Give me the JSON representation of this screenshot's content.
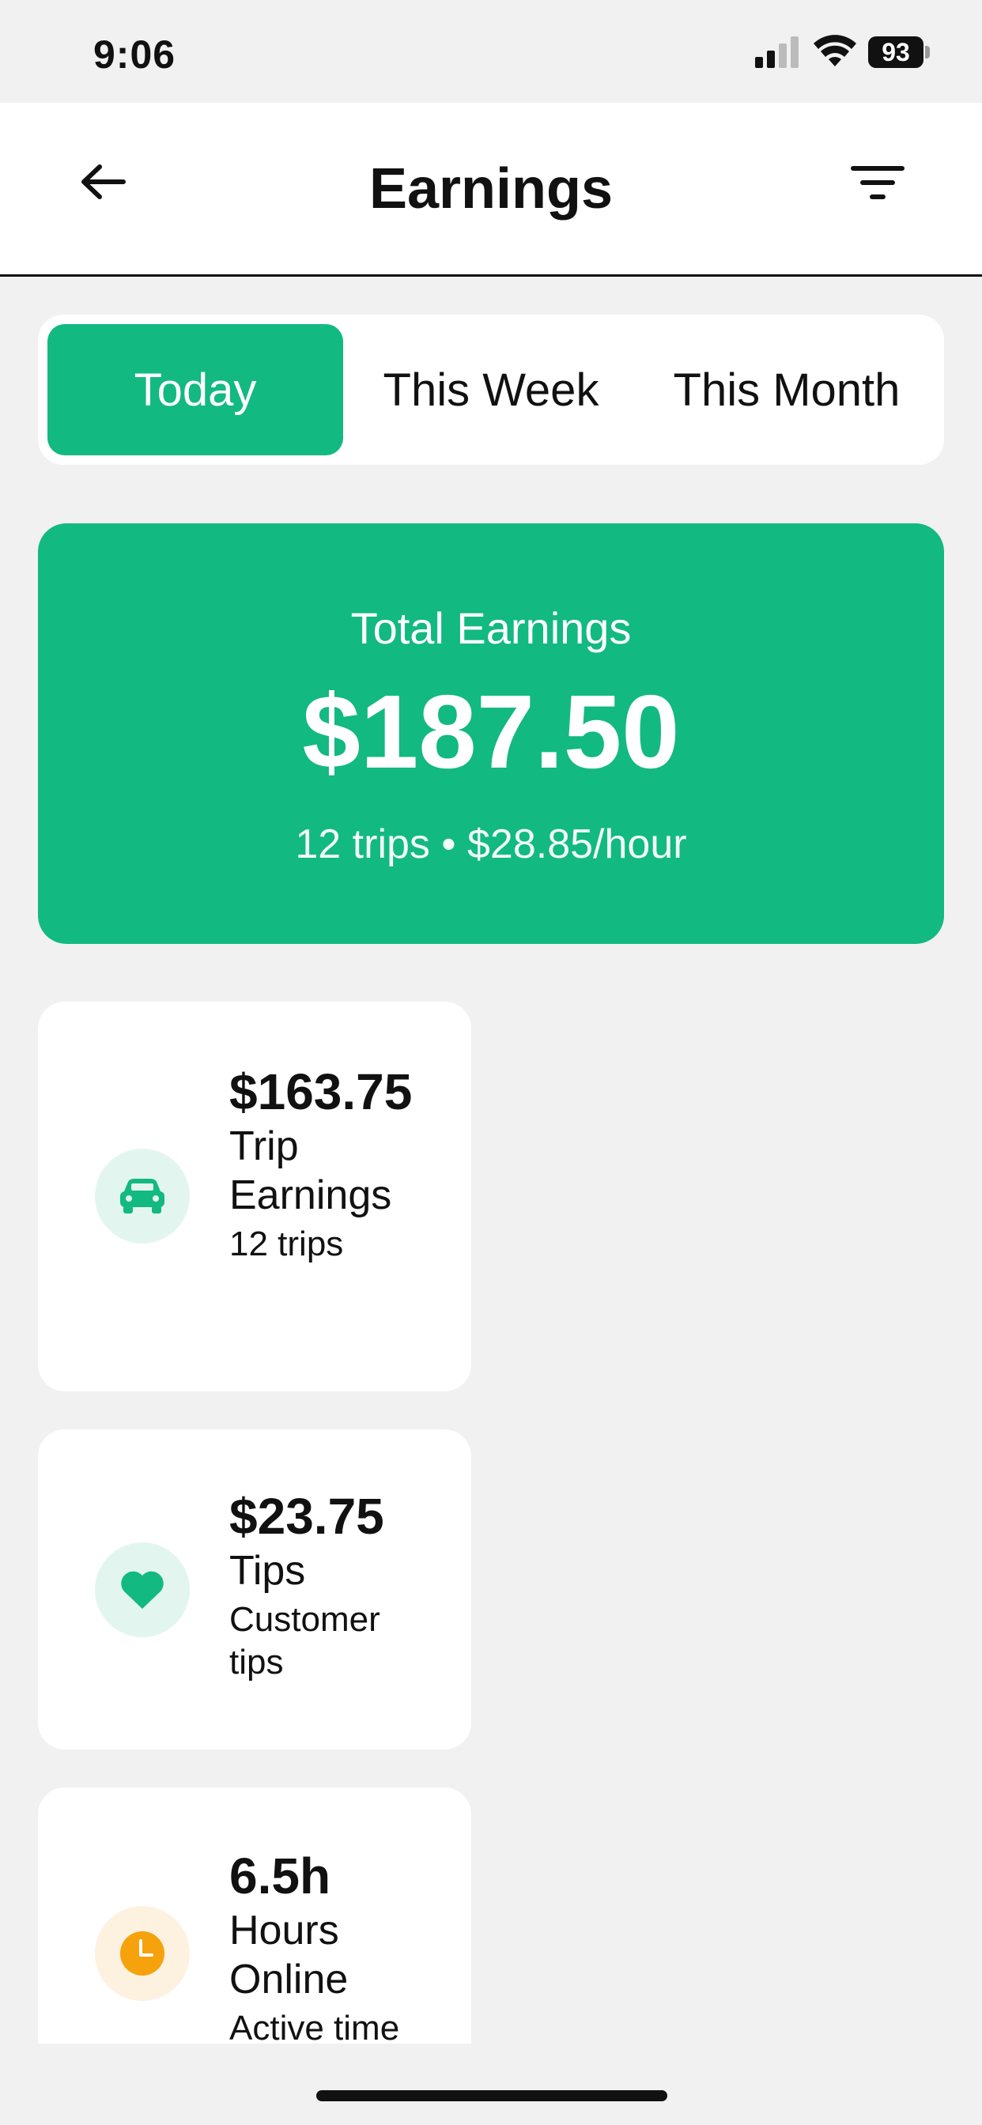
{
  "status_bar": {
    "time": "9:06",
    "battery": "93"
  },
  "header": {
    "title": "Earnings"
  },
  "tabs": [
    {
      "label": "Today",
      "active": true
    },
    {
      "label": "This Week",
      "active": false
    },
    {
      "label": "This Month",
      "active": false
    }
  ],
  "summary": {
    "label": "Total Earnings",
    "amount": "$187.50",
    "subtitle": "12 trips • $28.85/hour"
  },
  "stats": [
    {
      "value": "$163.75",
      "label": "Trip Earnings",
      "sub": "12 trips",
      "icon": "car-icon",
      "color": "#12b981"
    },
    {
      "value": "$23.75",
      "label": "Tips",
      "sub": "Customer tips",
      "icon": "heart-icon",
      "color": "#12b981"
    },
    {
      "value": "6.5h",
      "label": "Hours Online",
      "sub": "Active time",
      "icon": "clock-icon",
      "color": "#f5a20c"
    }
  ],
  "colors": {
    "accent": "#12b981",
    "background": "#f1f1f1",
    "clock": "#f5a20c"
  }
}
